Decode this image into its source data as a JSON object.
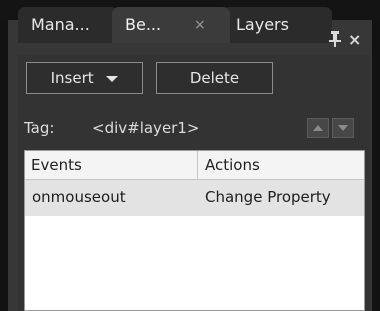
{
  "tabs": [
    {
      "label": "Mana..."
    },
    {
      "label": "Be...",
      "close": "×"
    },
    {
      "label": "Layers"
    }
  ],
  "panel_close": "×",
  "toolbar": {
    "insert_label": "Insert",
    "delete_label": "Delete"
  },
  "tag": {
    "label": "Tag:",
    "value": "<div#layer1>"
  },
  "grid": {
    "columns": [
      "Events",
      "Actions"
    ],
    "rows": [
      {
        "event": "onmouseout",
        "action": "Change Property"
      }
    ]
  }
}
